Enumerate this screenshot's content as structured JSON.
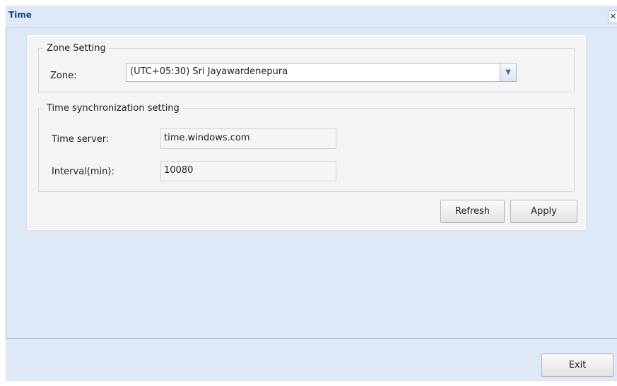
{
  "window": {
    "title": "Time",
    "close_glyph": "✕"
  },
  "zone_setting": {
    "legend": "Zone Setting",
    "zone_label": "Zone:",
    "zone_value": "(UTC+05:30) Sri Jayawardenepura",
    "dropdown_icon": "chevron-down-icon"
  },
  "time_sync": {
    "legend": "Time synchronization setting",
    "server_label": "Time server:",
    "server_value": "time.windows.com",
    "interval_label": "Interval(min):",
    "interval_value": "10080"
  },
  "buttons": {
    "refresh": "Refresh",
    "apply": "Apply",
    "exit": "Exit"
  },
  "colors": {
    "window_bg": "#dfe8f6",
    "title_text": "#15428b",
    "panel_bg": "#f4f4f4"
  }
}
